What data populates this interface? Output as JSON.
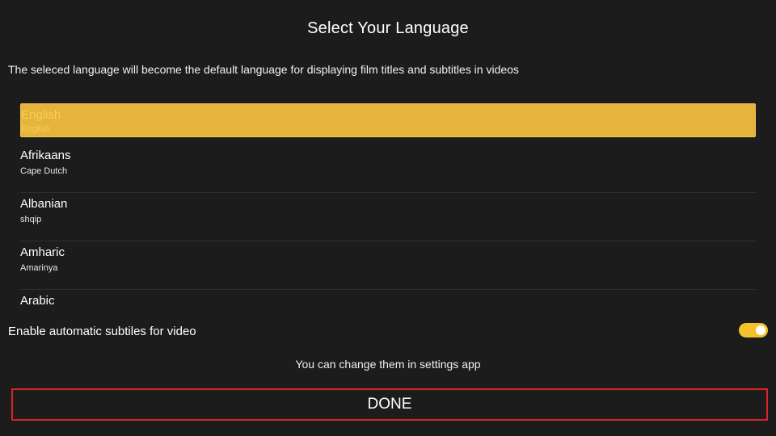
{
  "header": {
    "title": "Select Your Language",
    "description": "The seleced language will become the default language for displaying film titles and subtitles in videos"
  },
  "languages": [
    {
      "name": "English",
      "native": "English",
      "selected": true
    },
    {
      "name": "Afrikaans",
      "native": "Cape Dutch",
      "selected": false
    },
    {
      "name": "Albanian",
      "native": "shqip",
      "selected": false
    },
    {
      "name": "Amharic",
      "native": "Amarinya",
      "selected": false
    },
    {
      "name": "Arabic",
      "native": "",
      "selected": false
    }
  ],
  "subtitles": {
    "label": "Enable automatic subtiles for video",
    "enabled": true
  },
  "footer": {
    "hint": "You can change them in settings app",
    "done_label": "DONE"
  },
  "colors": {
    "background": "#1c1c1c",
    "selected_item": "#e6b43a",
    "toggle_on": "#f3c12b",
    "done_border": "#d9242b"
  }
}
